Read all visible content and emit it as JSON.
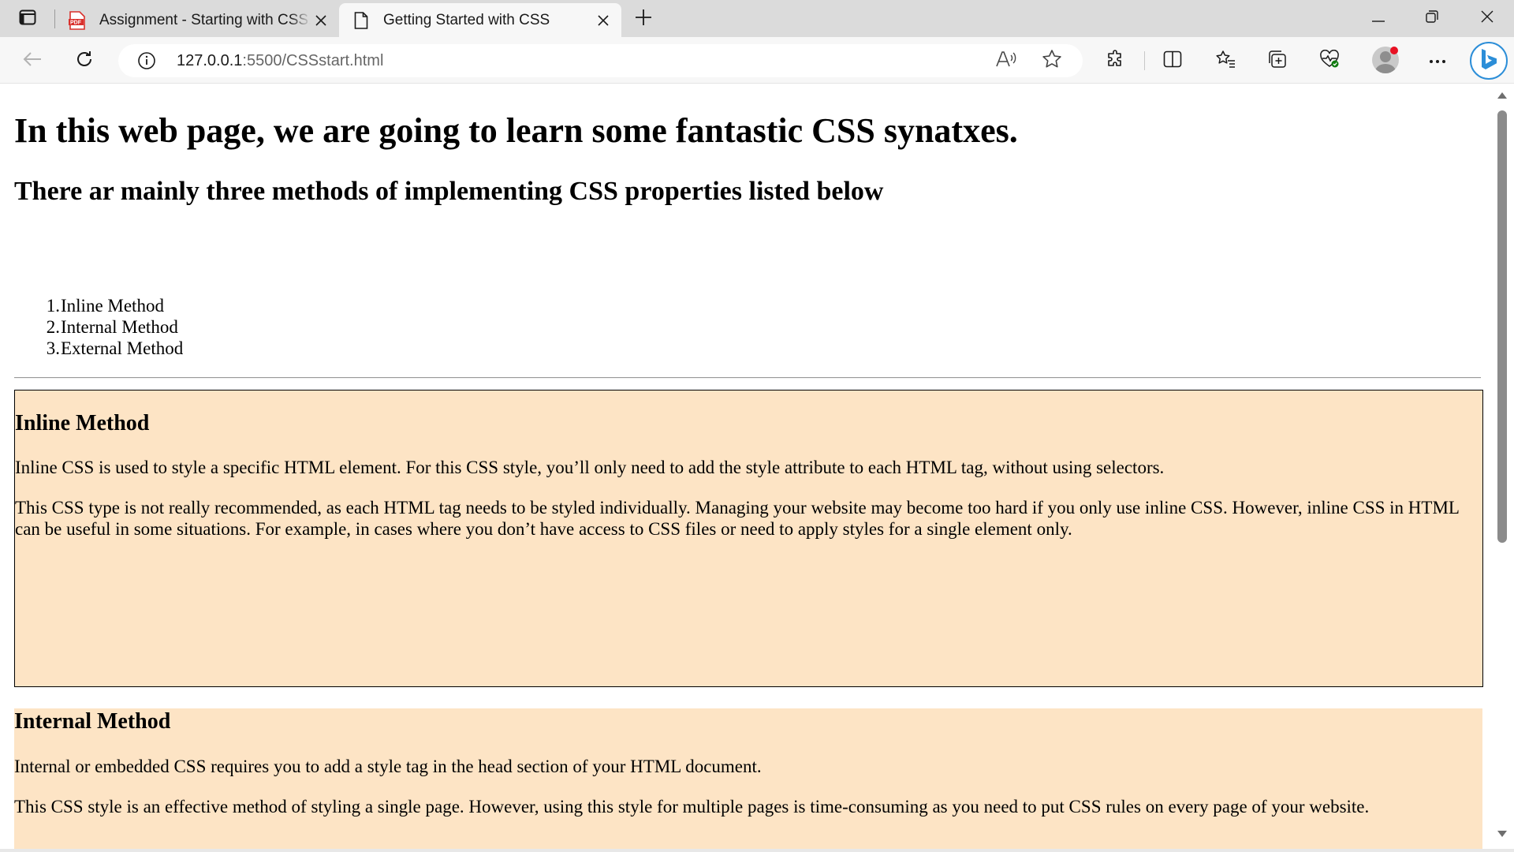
{
  "browser": {
    "tabs": [
      {
        "title": "Assignment - Starting with CSS.pdf",
        "favicon": "pdf-icon",
        "active": false
      },
      {
        "title": "Getting Started with CSS",
        "favicon": "document-icon",
        "active": true
      }
    ],
    "address": {
      "host": "127.0.0.1",
      "path": ":5500/CSSstart.html"
    },
    "colors": {
      "tab_strip": "#dbdbdb",
      "toolbar": "#f7f7f7",
      "pdf_red": "#d9302c",
      "bing_blue": "#2c8ed8"
    }
  },
  "page": {
    "h1": "In this web page, we are going to learn some fantastic CSS synatxes.",
    "h2": "There ar mainly three methods of implementing CSS properties listed below",
    "methods": [
      {
        "num": "1.",
        "label": "Inline Method"
      },
      {
        "num": "2.",
        "label": "Internal Method"
      },
      {
        "num": "3.",
        "label": "External Method"
      }
    ],
    "sections": [
      {
        "heading": "Inline Method",
        "paragraphs": [
          "Inline CSS is used to style a specific HTML element. For this CSS style, you’ll only need to add the style attribute to each HTML tag, without using selectors.",
          "This CSS type is not really recommended, as each HTML tag needs to be styled individually. Managing your website may become too hard if you only use inline CSS. However, inline CSS in HTML can be useful in some situations. For example, in cases where you don’t have access to CSS files or need to apply styles for a single element only."
        ]
      },
      {
        "heading": "Internal Method",
        "paragraphs": [
          "Internal or embedded CSS requires you to add a style tag in the head section of your HTML document.",
          "This CSS style is an effective method of styling a single page. However, using this style for multiple pages is time-consuming as you need to put CSS rules on every page of your website."
        ]
      }
    ],
    "colors": {
      "section_background": "#fde4c5"
    }
  }
}
